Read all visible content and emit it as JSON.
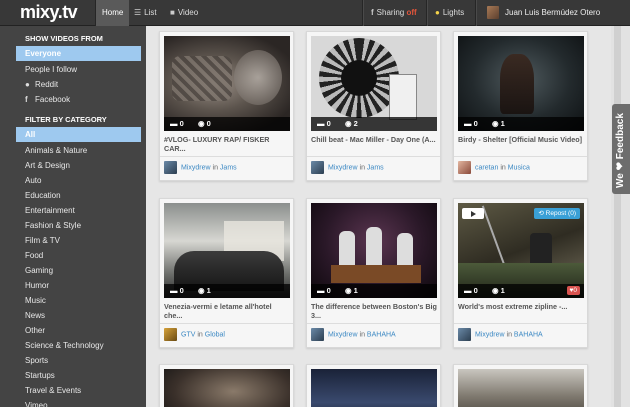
{
  "header": {
    "logo": "mixy.tv",
    "nav": [
      {
        "label": "Home"
      },
      {
        "label": "List"
      },
      {
        "label": "Video"
      }
    ],
    "sharing_label": "Sharing",
    "sharing_state": "off",
    "lights_label": "Lights",
    "user_name": "Juan Luis Bermúdez Otero"
  },
  "sidebar": {
    "show_heading": "SHOW VIDEOS FROM",
    "sources": [
      "Everyone",
      "People I follow",
      "Reddit",
      "Facebook"
    ],
    "category_heading": "FILTER BY CATEGORY",
    "categories": [
      "All",
      "Animals & Nature",
      "Art & Design",
      "Auto",
      "Education",
      "Entertainment",
      "Fashion & Style",
      "Film & TV",
      "Food",
      "Gaming",
      "Humor",
      "Music",
      "News",
      "Other",
      "Science & Technology",
      "Sports",
      "Startups",
      "Travel & Events",
      "Vimeo"
    ]
  },
  "videos": [
    {
      "title": "#VLOG- LUXURY RAP/ FISKER CAR...",
      "comments": "0",
      "views": "0",
      "user": "Mixydrew",
      "in": "in",
      "channel": "Jams"
    },
    {
      "title": "Chill beat - Mac Miller - Day One (A...",
      "comments": "0",
      "views": "2",
      "user": "Mixydrew",
      "in": "in",
      "channel": "Jams"
    },
    {
      "title": "Birdy - Shelter [Official Music Video]",
      "comments": "0",
      "views": "1",
      "user": "caretan",
      "in": "in",
      "channel": "Musica"
    },
    {
      "title": "Venezia-vermi e letame all'hotel che...",
      "comments": "0",
      "views": "1",
      "user": "GTV",
      "in": "in",
      "channel": "Global"
    },
    {
      "title": "The difference between Boston's Big 3...",
      "comments": "0",
      "views": "1",
      "user": "Mixydrew",
      "in": "in",
      "channel": "BAHAHA"
    },
    {
      "title": "World's most extreme zipline -...",
      "comments": "0",
      "views": "1",
      "user": "Mixydrew",
      "in": "in",
      "channel": "BAHAHA",
      "repost": "Repost (0)",
      "likes": "0"
    }
  ],
  "feedback_label": "We ❤ Feedback",
  "colors": {
    "topbar": "#383838",
    "sidebar": "#444444",
    "selected": "#9ec9ef",
    "link": "#3b88c3",
    "repost": "#3aa0d6"
  }
}
